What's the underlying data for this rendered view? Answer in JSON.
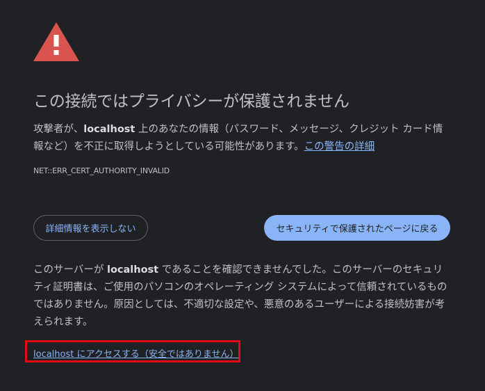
{
  "page": {
    "title": "この接続ではプライバシーが保護されません",
    "intro": {
      "prefix": "攻撃者が、",
      "host": "localhost",
      "middle": " 上のあなたの情報（パスワード、メッセージ、クレジット カード情報など）を不正に取得しようとしている可能性があります。",
      "learn_more": "この警告の詳細"
    },
    "error_code": "NET::ERR_CERT_AUTHORITY_INVALID",
    "buttons": {
      "details": "詳細情報を表示しない",
      "back": "セキュリティで保護されたページに戻る"
    },
    "details": {
      "prefix": "このサーバーが ",
      "host": "localhost",
      "body": " であることを確認できませんでした。このサーバーのセキュリティ証明書は、ご使用のパソコンのオペレーティング システムによって信頼されているものではありません。原因としては、不適切な設定や、悪意のあるユーザーによる接続妨害が考えられます。"
    },
    "proceed_link": "localhost にアクセスする（安全ではありません）"
  },
  "colors": {
    "background": "#202124",
    "text": "#bdc1c6",
    "link": "#8ab4f8",
    "warning_icon": "#d9534f",
    "highlight_box": "#e50914"
  },
  "icons": {
    "warning": "warning-triangle-icon"
  }
}
